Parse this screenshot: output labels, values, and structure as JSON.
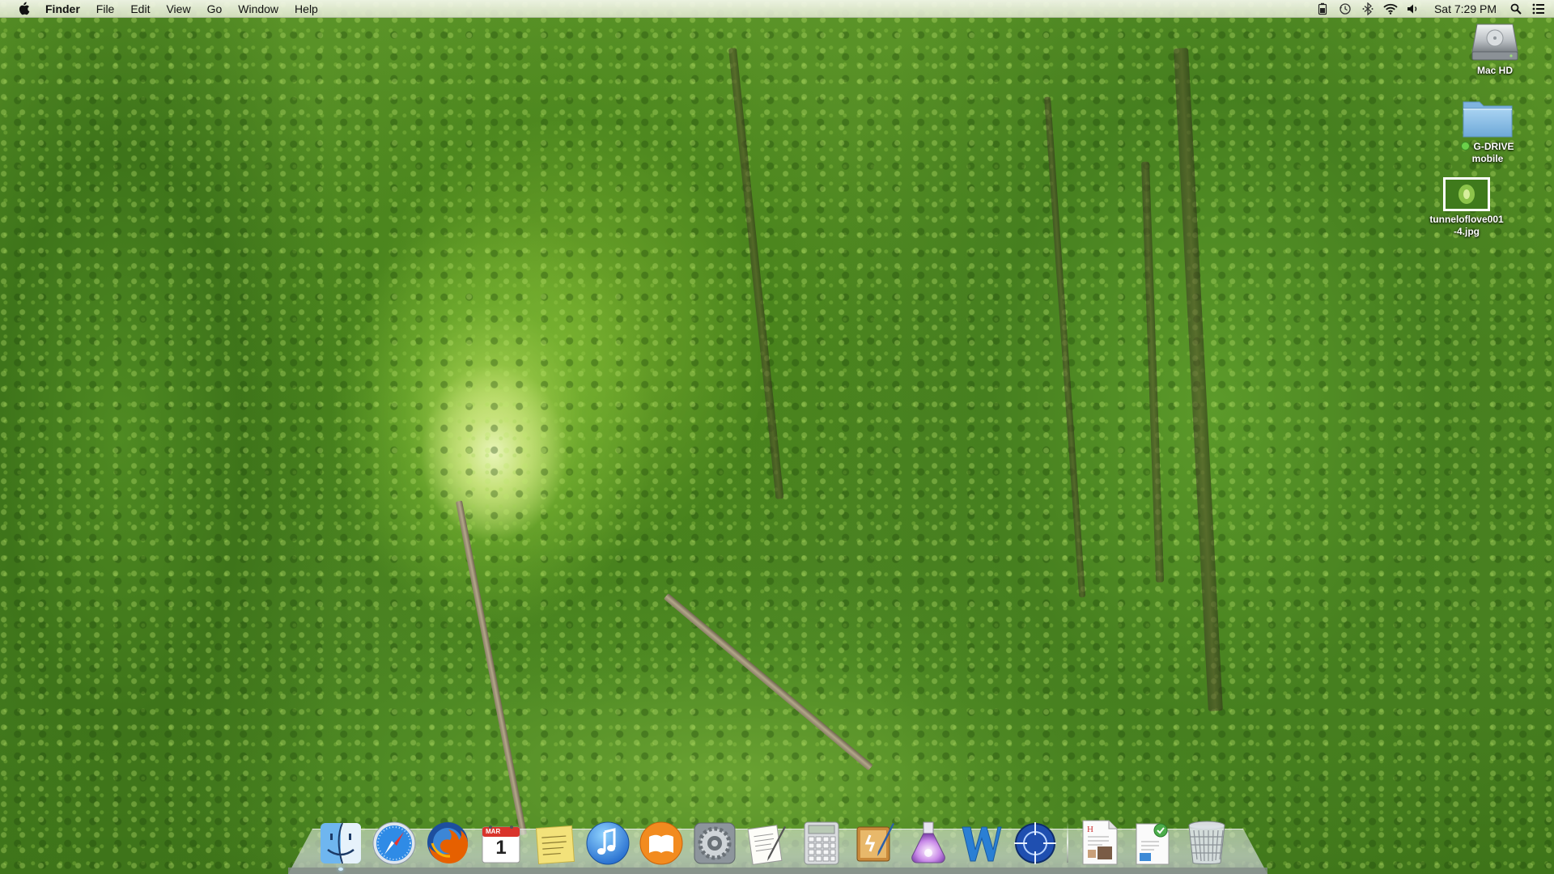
{
  "menubar": {
    "apple_icon": "apple-icon",
    "app_name": "Finder",
    "menus": [
      "File",
      "Edit",
      "View",
      "Go",
      "Window",
      "Help"
    ],
    "status_icons": [
      "battery-icon",
      "time-machine-icon",
      "bluetooth-icon",
      "wifi-icon",
      "volume-icon"
    ],
    "clock": "Sat 7:29 PM",
    "search_icon": "spotlight-search-icon",
    "notification_icon": "notification-center-icon"
  },
  "desktop_icons": [
    {
      "label": "Mac HD",
      "icon": "hard-drive-icon"
    },
    {
      "label": "G-DRIVE\nmobile",
      "icon": "folder-icon",
      "tag_color": "#6bd04a"
    },
    {
      "label": "tunneloflove001\n-4.jpg",
      "icon": "image-file-icon"
    }
  ],
  "dock": {
    "apps": [
      {
        "name": "Finder",
        "icon": "finder-icon",
        "running": true
      },
      {
        "name": "Safari",
        "icon": "safari-icon",
        "running": false
      },
      {
        "name": "Firefox",
        "icon": "firefox-icon",
        "running": false
      },
      {
        "name": "Calendar",
        "icon": "calendar-icon",
        "running": false,
        "month": "MAR",
        "day": "1"
      },
      {
        "name": "Stickies",
        "icon": "stickies-icon",
        "running": false
      },
      {
        "name": "iTunes",
        "icon": "itunes-icon",
        "running": false
      },
      {
        "name": "iBooks",
        "icon": "ibooks-icon",
        "running": false
      },
      {
        "name": "System Preferences",
        "icon": "system-preferences-icon",
        "running": false
      },
      {
        "name": "TextEdit",
        "icon": "textedit-icon",
        "running": false
      },
      {
        "name": "Calculator",
        "icon": "calculator-icon",
        "running": false
      },
      {
        "name": "Script Editor",
        "icon": "script-editor-icon",
        "running": false
      },
      {
        "name": "Potion",
        "icon": "potion-flask-icon",
        "running": false
      },
      {
        "name": "Word",
        "icon": "word-icon",
        "running": false
      },
      {
        "name": "Crosshair",
        "icon": "crosshair-icon",
        "running": false
      }
    ],
    "stacks": [
      {
        "name": "Document",
        "icon": "document-stack-icon"
      },
      {
        "name": "Downloads",
        "icon": "downloads-stack-icon"
      },
      {
        "name": "Trash",
        "icon": "trash-icon"
      }
    ]
  }
}
